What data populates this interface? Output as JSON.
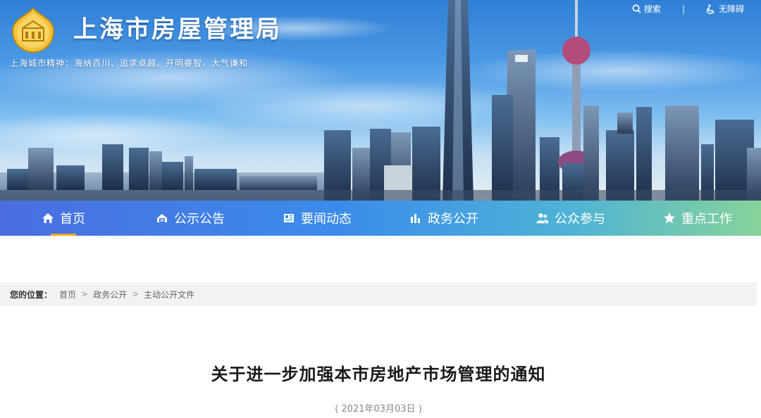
{
  "header": {
    "site_title": "上海市房屋管理局",
    "motto": "上海城市精神：海纳百川、追求卓越、开明睿智、大气谦和",
    "tools": {
      "search_label": "搜索",
      "separator": "|",
      "accessibility_label": "无障碍"
    }
  },
  "nav": {
    "items": [
      {
        "label": "首页",
        "icon": "home-icon",
        "active": true
      },
      {
        "label": "公示公告",
        "icon": "notice-icon"
      },
      {
        "label": "要闻动态",
        "icon": "news-icon"
      },
      {
        "label": "政务公开",
        "icon": "chart-icon"
      },
      {
        "label": "公众参与",
        "icon": "users-icon"
      },
      {
        "label": "重点工作",
        "icon": "star-icon"
      }
    ],
    "active_color": "#f6a623"
  },
  "breadcrumb": {
    "label": "您的位置：",
    "items": [
      "首页",
      "政务公开",
      "主动公开文件"
    ],
    "separator": ">"
  },
  "article": {
    "title": "关于进一步加强本市房地产市场管理的通知",
    "date": "( 2021年03月03日 )"
  }
}
